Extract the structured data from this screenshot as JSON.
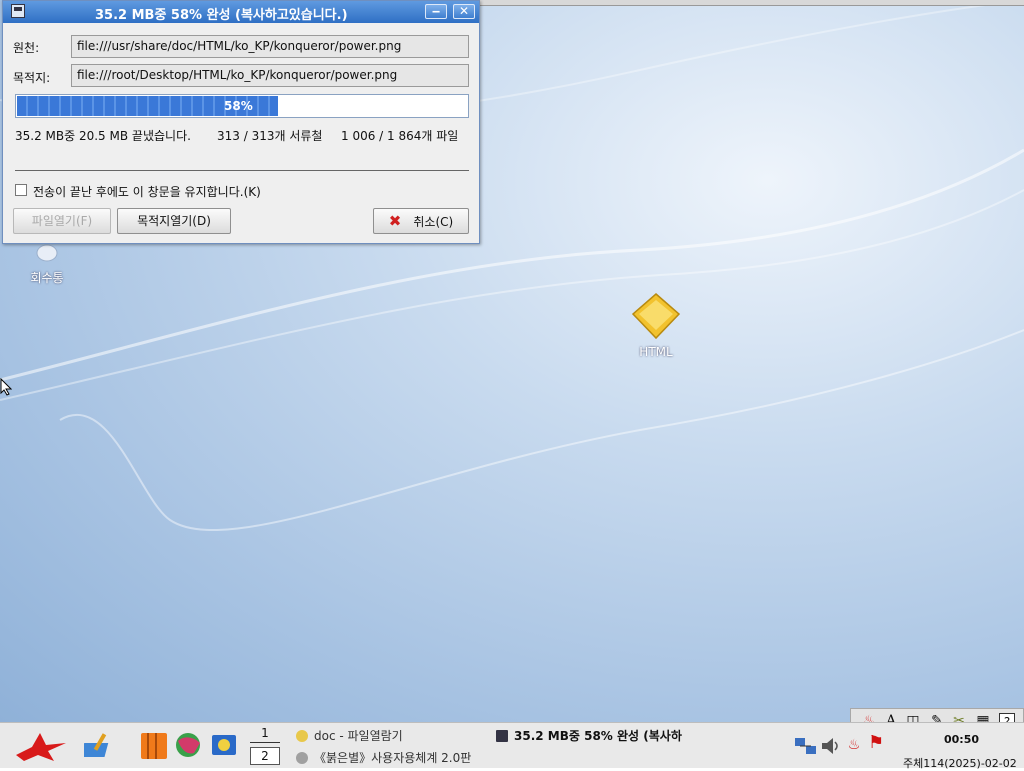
{
  "dialog": {
    "title": "35.2 MB중 58% 완성 (복사하고있습니다.)",
    "source_label": "원천:",
    "source_value": "file:///usr/share/doc/HTML/ko_KP/konqueror/power.png",
    "dest_label": "목적지:",
    "dest_value": "file:///root/Desktop/HTML/ko_KP/konqueror/power.png",
    "progress_percent": 58,
    "progress_text": "58%",
    "stats_size": "35.2 MB중 20.5 MB 끝냈습니다.",
    "stats_dirs": "313 / 313개 서류철",
    "stats_files": "1 006 / 1 864개 파일",
    "keep_open_label": "전송이 끝난 후에도 이 창문을 유지합니다.(K)",
    "keep_open_checked": false,
    "open_file_button": "파일열기(F)",
    "open_dest_button": "목적지열기(D)",
    "cancel_button": "취소(C)",
    "minimize_glyph": "‒",
    "close_glyph": "✕"
  },
  "desktop": {
    "icons": [
      {
        "label": "회수통",
        "icon": "trash-icon"
      },
      {
        "label": "HTML",
        "icon": "folder-icon"
      }
    ]
  },
  "taskbar": {
    "pager": [
      "1",
      "2"
    ],
    "tasks": [
      {
        "label": "doc - 파일열람기",
        "icon": "file-browser-icon"
      },
      {
        "label": "《붉은별》사용자용체계 2.0판",
        "icon": "globe-icon"
      },
      {
        "label": "35.2 MB중 58% 완성 (복사하",
        "icon": "copy-progress-icon"
      }
    ],
    "clock": "00:50",
    "date": "주체114(2025)-02-02"
  },
  "colors": {
    "titlebar": "#2f6fc4",
    "progress": "#3a78d8",
    "desktop": "#a9c4e3"
  }
}
